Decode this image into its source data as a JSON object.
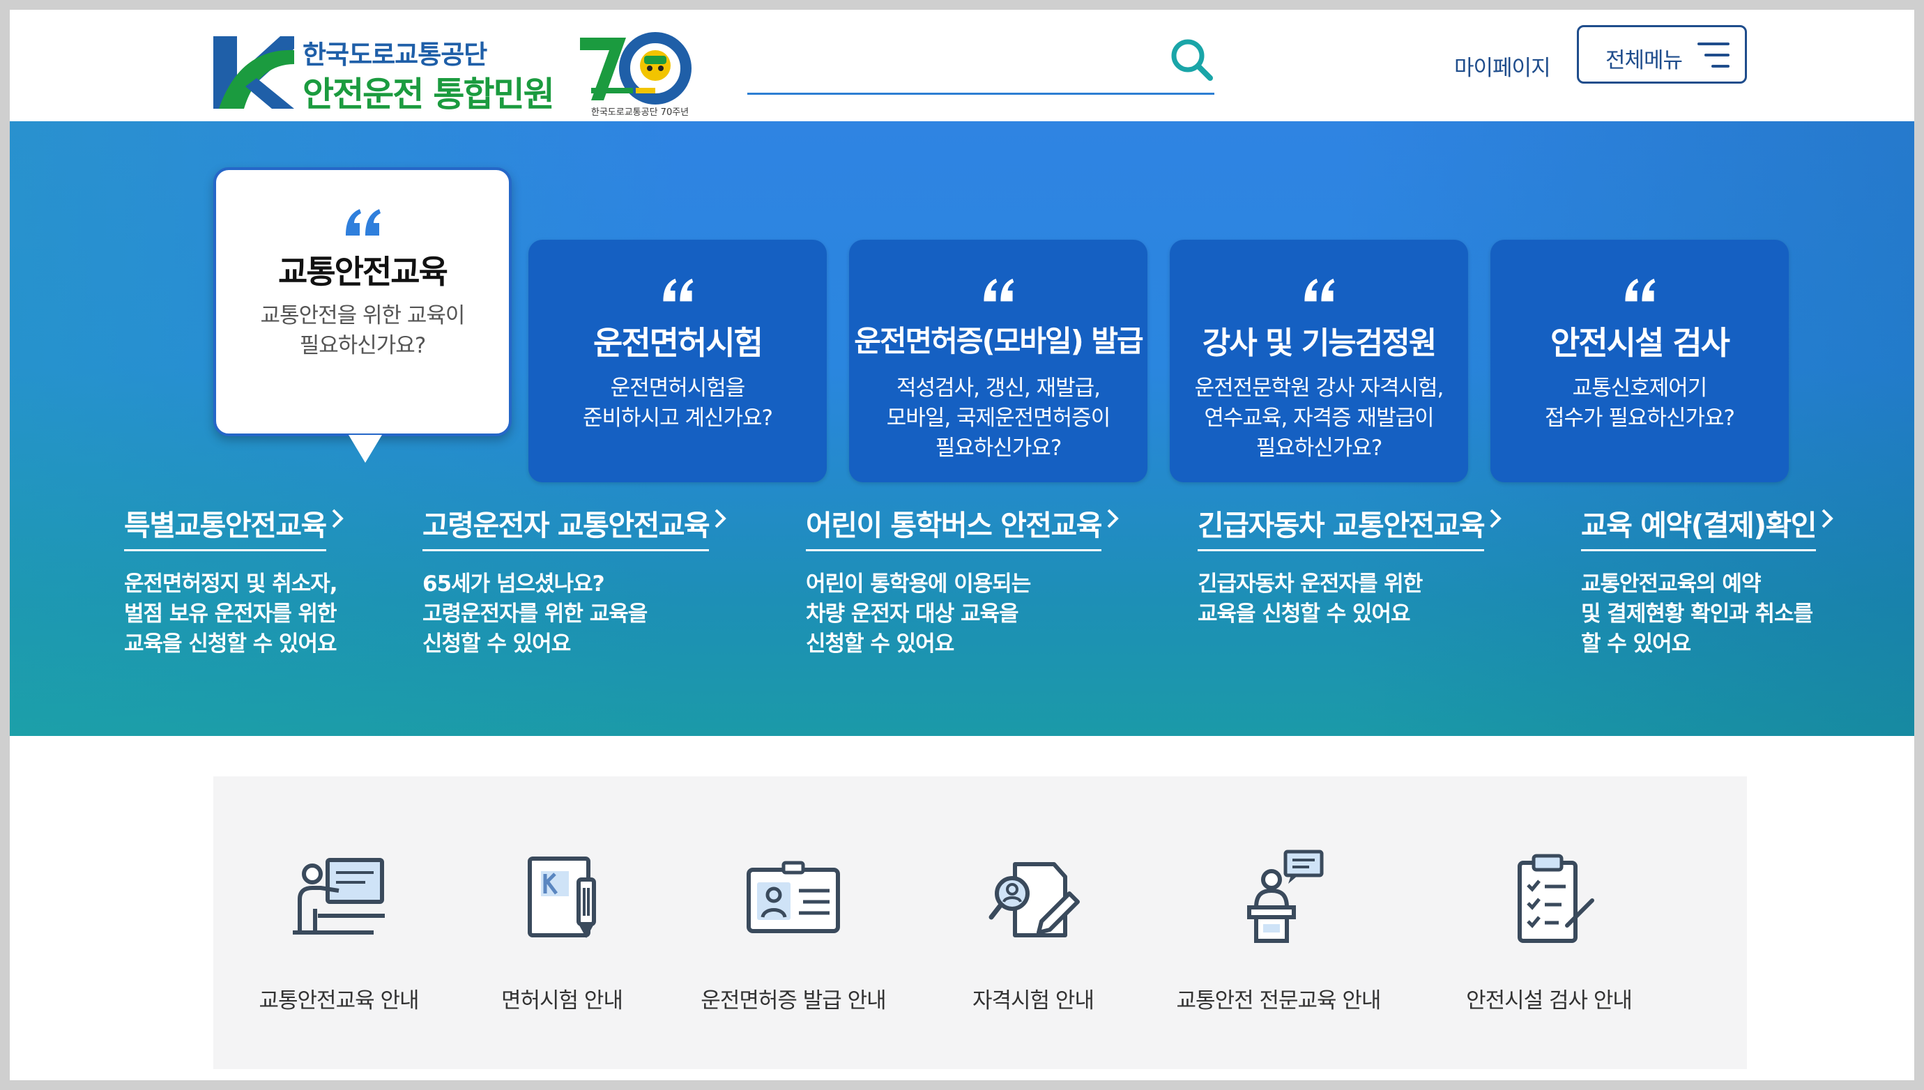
{
  "header": {
    "org_name": "한국도로교통공단",
    "site_name": "안전운전 통합민원",
    "anniversary_caption": "한국도로교통공단 70주년",
    "search_placeholder": "",
    "mypage_label": "마이페이지",
    "allmenu_label": "전체메뉴"
  },
  "colors": {
    "brand_blue": "#1f4d8c",
    "brand_green": "#1b9b3f",
    "card_blue": "#1560c2",
    "hero_top": "#2f84e2",
    "hero_bottom": "#1b9aa8"
  },
  "cards": [
    {
      "title": "교통안전교육",
      "desc_line1": "교통안전을 위한 교육이",
      "desc_line2": "필요하신가요?",
      "desc_line3": "",
      "active": true
    },
    {
      "title": "운전면허시험",
      "desc_line1": "운전면허시험을",
      "desc_line2": "준비하시고 계신가요?",
      "desc_line3": "",
      "active": false
    },
    {
      "title": "운전면허증(모바일) 발급",
      "desc_line1": "적성검사, 갱신, 재발급,",
      "desc_line2": "모바일, 국제운전면허증이",
      "desc_line3": "필요하신가요?",
      "active": false
    },
    {
      "title": "강사 및 기능검정원",
      "desc_line1": "운전전문학원 강사 자격시험,",
      "desc_line2": "연수교육, 자격증 재발급이",
      "desc_line3": "필요하신가요?",
      "active": false
    },
    {
      "title": "안전시설 검사",
      "desc_line1": "교통신호제어기",
      "desc_line2": "접수가 필요하신가요?",
      "desc_line3": "",
      "active": false
    }
  ],
  "links": [
    {
      "title": "특별교통안전교육",
      "desc_line1": "운전면허정지 및 취소자,",
      "desc_line2": "벌점 보유 운전자를 위한",
      "desc_line3": "교육을 신청할 수 있어요"
    },
    {
      "title": "고령운전자 교통안전교육",
      "desc_line1": "65세가 넘으셨나요?",
      "desc_line2": "고령운전자를 위한 교육을",
      "desc_line3": "신청할 수 있어요"
    },
    {
      "title": "어린이 통학버스 안전교육",
      "desc_line1": "어린이 통학용에 이용되는",
      "desc_line2": "차량 운전자 대상 교육을",
      "desc_line3": "신청할 수 있어요"
    },
    {
      "title": "긴급자동차 교통안전교육",
      "desc_line1": "긴급자동차 운전자를 위한",
      "desc_line2": "교육을 신청할 수 있어요",
      "desc_line3": ""
    },
    {
      "title": "교육 예약(결제)확인",
      "desc_line1": "교통안전교육의 예약",
      "desc_line2": "및 결제현황 확인과 취소를",
      "desc_line3": "할 수 있어요"
    }
  ],
  "quick_menu": [
    {
      "label": "교통안전교육 안내",
      "icon": "lecture-icon"
    },
    {
      "label": "면허시험 안내",
      "icon": "exam-document-icon"
    },
    {
      "label": "운전면허증 발급 안내",
      "icon": "id-card-icon"
    },
    {
      "label": "자격시험 안내",
      "icon": "qualification-icon"
    },
    {
      "label": "교통안전 전문교육 안내",
      "icon": "podium-speaker-icon"
    },
    {
      "label": "안전시설 검사 안내",
      "icon": "checklist-clipboard-icon"
    }
  ]
}
